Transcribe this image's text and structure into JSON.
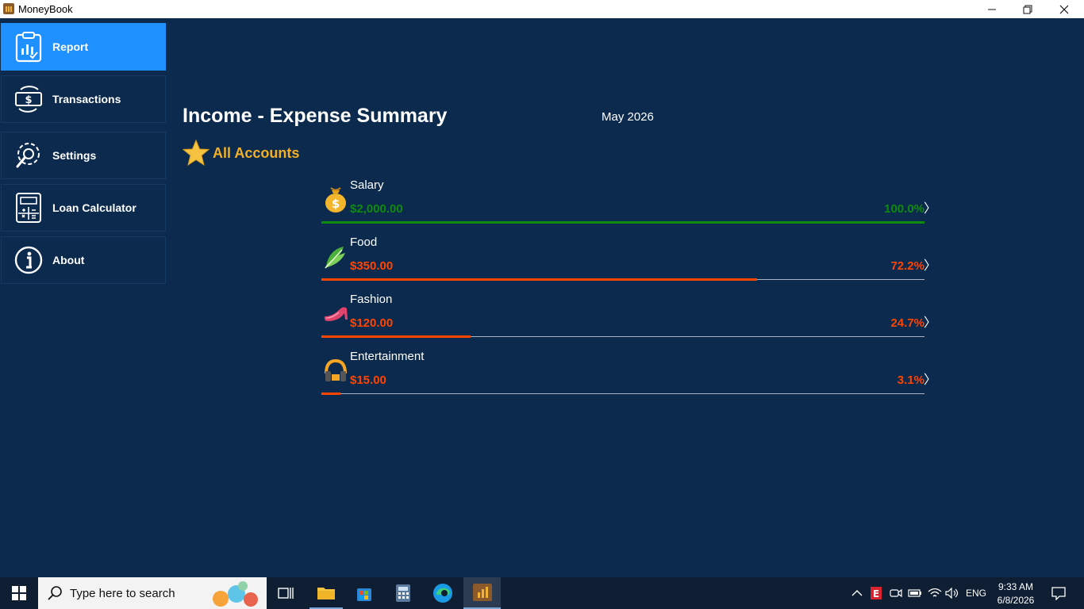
{
  "window": {
    "title": "MoneyBook"
  },
  "colors": {
    "background": "#0b2a4d",
    "active_nav": "#1e90ff",
    "income": "#0f8a0f",
    "expense": "#ff4500",
    "accent": "#f3b024"
  },
  "sidebar": {
    "items": [
      {
        "label": "Report",
        "icon": "report-clipboard-icon",
        "active": true
      },
      {
        "label": "Transactions",
        "icon": "money-exchange-icon",
        "active": false
      },
      {
        "label": "Settings",
        "icon": "gear-wrench-icon",
        "active": false
      },
      {
        "label": "Loan Calculator",
        "icon": "calculator-icon",
        "active": false
      },
      {
        "label": "About",
        "icon": "info-icon",
        "active": false
      }
    ]
  },
  "report": {
    "title": "Income - Expense Summary",
    "month": "May 2026",
    "account": "All Accounts",
    "categories": [
      {
        "name": "Salary",
        "amount": "$2,000.00",
        "percent": "100.0%",
        "ratio": 1.0,
        "type": "income",
        "icon": "money-bag-icon"
      },
      {
        "name": "Food",
        "amount": "$350.00",
        "percent": "72.2%",
        "ratio": 0.722,
        "type": "expense",
        "icon": "leafy-greens-icon"
      },
      {
        "name": "Fashion",
        "amount": "$120.00",
        "percent": "24.7%",
        "ratio": 0.247,
        "type": "expense",
        "icon": "high-heel-icon"
      },
      {
        "name": "Entertainment",
        "amount": "$15.00",
        "percent": "3.1%",
        "ratio": 0.031,
        "type": "expense",
        "icon": "headphones-icon"
      }
    ]
  },
  "taskbar": {
    "search_placeholder": "Type here to search",
    "language": "ENG",
    "time": "9:33 AM",
    "date": "6/8/2026"
  }
}
